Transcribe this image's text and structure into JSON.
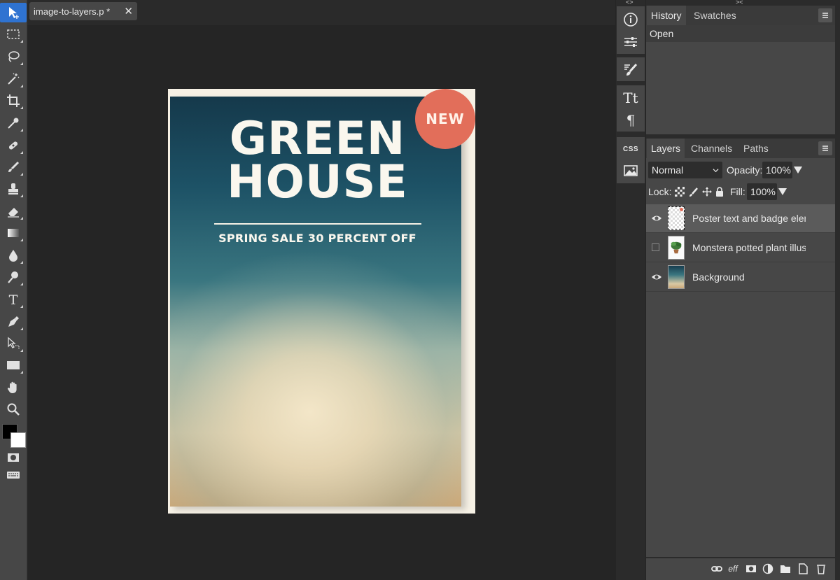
{
  "document": {
    "tab_title": "image-to-layers.p",
    "modified_mark": "*",
    "close_glyph": "✕"
  },
  "poster": {
    "title": "GREEN\nHOUSE",
    "subtitle": "SPRING SALE 30 PERCENT OFF",
    "badge": "NEW",
    "colors": {
      "badge": "#e26e5a",
      "paper": "#f6f1e5",
      "sky_top": "#15394b",
      "glow": "#f3e6c8"
    }
  },
  "tools": [
    "move-icon",
    "marquee-icon",
    "lasso-icon",
    "magic-wand-icon",
    "crop-icon",
    "eyedropper-icon",
    "healing-icon",
    "brush-icon",
    "stamp-icon",
    "eraser-icon",
    "gradient-icon",
    "blur-icon",
    "dodge-icon",
    "type-icon",
    "pen-icon",
    "path-select-icon",
    "shape-icon",
    "hand-icon",
    "zoom-icon"
  ],
  "colors": {
    "foreground": "#000000",
    "background": "#ffffff",
    "accent": "#2f73d1"
  },
  "history_panel": {
    "tabs": [
      "History",
      "Swatches"
    ],
    "items": [
      "Open"
    ]
  },
  "layers_panel": {
    "tabs": [
      "Layers",
      "Channels",
      "Paths"
    ],
    "blend_mode": "Normal",
    "opacity_label": "Opacity:",
    "opacity_value": "100%",
    "lock_label": "Lock:",
    "fill_label": "Fill:",
    "fill_value": "100%",
    "layers": [
      {
        "name": "Poster text and badge eler",
        "visible": true,
        "selected": true
      },
      {
        "name": "Monstera potted plant illus",
        "visible": false,
        "selected": false
      },
      {
        "name": "Background",
        "visible": true,
        "selected": false
      }
    ],
    "footer_eff_label": "eff"
  },
  "strip": {
    "css_label": "CSS",
    "collapse_left": "<>",
    "collapse_right": "><"
  }
}
